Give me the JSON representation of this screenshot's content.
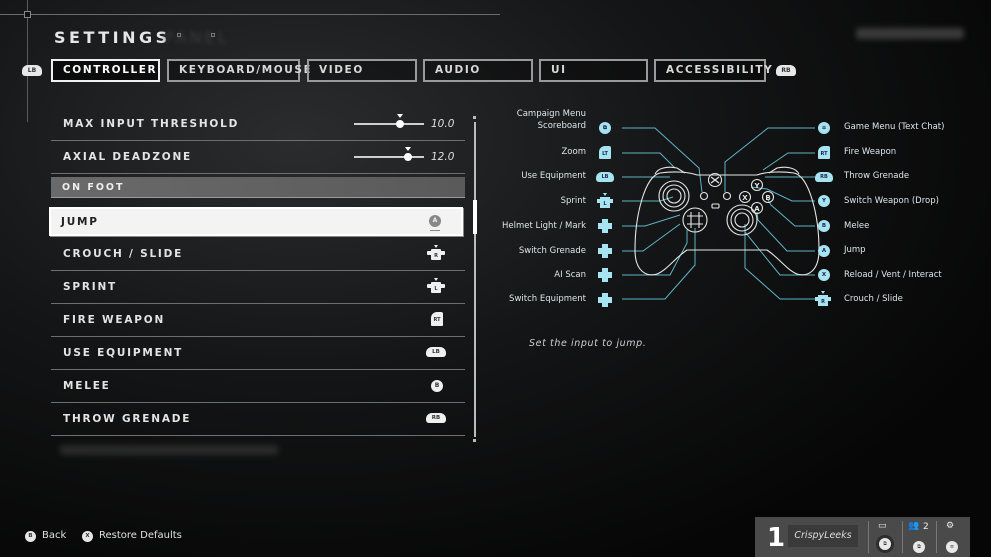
{
  "header": {
    "title": "SETTINGS",
    "left_bumper": "LB",
    "right_bumper": "RB"
  },
  "tabs": [
    {
      "label": "CONTROLLER",
      "active": true
    },
    {
      "label": "KEYBOARD/MOUSE",
      "active": false
    },
    {
      "label": "VIDEO",
      "active": false
    },
    {
      "label": "AUDIO",
      "active": false
    },
    {
      "label": "UI",
      "active": false
    },
    {
      "label": "ACCESSIBILITY",
      "active": false
    }
  ],
  "settings": {
    "sliders": [
      {
        "label": "MAX INPUT THRESHOLD",
        "value": "10.0",
        "fill_fraction": 0.65
      },
      {
        "label": "AXIAL DEADZONE",
        "value": "12.0",
        "fill_fraction": 0.77
      }
    ],
    "section_header": "ON FOOT",
    "bindings": [
      {
        "label": "JUMP",
        "glyph": "A",
        "glyph_type": "face-button",
        "selected": true
      },
      {
        "label": "CROUCH / SLIDE",
        "glyph": "R",
        "glyph_type": "stick-click"
      },
      {
        "label": "SPRINT",
        "glyph": "L",
        "glyph_type": "stick-click"
      },
      {
        "label": "FIRE WEAPON",
        "glyph": "RT",
        "glyph_type": "trigger"
      },
      {
        "label": "USE EQUIPMENT",
        "glyph": "LB",
        "glyph_type": "bumper"
      },
      {
        "label": "MELEE",
        "glyph": "B",
        "glyph_type": "face-button"
      },
      {
        "label": "THROW GRENADE",
        "glyph": "RB",
        "glyph_type": "bumper"
      }
    ]
  },
  "controller_map": {
    "left": [
      {
        "label_line1": "Campaign Menu",
        "label_line2": "Scoreboard",
        "glyph": "⧉",
        "glyph_type": "view-button"
      },
      {
        "label": "Zoom",
        "glyph": "LT",
        "glyph_type": "trigger"
      },
      {
        "label": "Use Equipment",
        "glyph": "LB",
        "glyph_type": "bumper"
      },
      {
        "label": "Sprint",
        "glyph": "L",
        "glyph_type": "stick-click"
      },
      {
        "label": "Helmet Light / Mark",
        "glyph": "up",
        "glyph_type": "dpad"
      },
      {
        "label": "Switch Grenade",
        "glyph": "left",
        "glyph_type": "dpad"
      },
      {
        "label": "AI Scan",
        "glyph": "down",
        "glyph_type": "dpad"
      },
      {
        "label": "Switch Equipment",
        "glyph": "right",
        "glyph_type": "dpad"
      }
    ],
    "right": [
      {
        "label": "Game Menu (Text Chat)",
        "glyph": "≡",
        "glyph_type": "menu-button"
      },
      {
        "label": "Fire Weapon",
        "glyph": "RT",
        "glyph_type": "trigger"
      },
      {
        "label": "Throw Grenade",
        "glyph": "RB",
        "glyph_type": "bumper"
      },
      {
        "label": "Switch Weapon (Drop)",
        "glyph": "Y",
        "glyph_type": "face-button"
      },
      {
        "label": "Melee",
        "glyph": "B",
        "glyph_type": "face-button"
      },
      {
        "label": "Jump",
        "glyph": "A",
        "glyph_type": "face-button"
      },
      {
        "label": "Reload / Vent / Interact",
        "glyph": "X",
        "glyph_type": "face-button"
      },
      {
        "label": "Crouch / Slide",
        "glyph": "R",
        "glyph_type": "stick-click"
      }
    ],
    "controller_face_buttons": [
      "Y",
      "X",
      "B",
      "A"
    ],
    "accent_color": "#a6e4f2"
  },
  "description": "Set the input to jump.",
  "footer": {
    "back": {
      "glyph": "B",
      "label": "Back"
    },
    "restore": {
      "glyph": "X",
      "label": "Restore Defaults"
    }
  },
  "player_bar": {
    "player_number": "1",
    "gamertag": "CrispyLeeks",
    "party_count": "2",
    "icons": [
      "chat-icon",
      "party-icon",
      "settings-gear-icon"
    ]
  }
}
